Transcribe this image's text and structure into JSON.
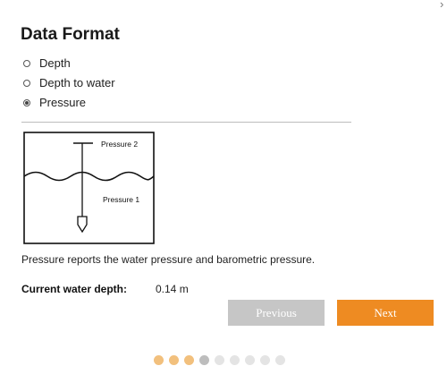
{
  "window": {
    "corner_glyph": "›"
  },
  "page": {
    "title": "Data Format"
  },
  "options": [
    {
      "label": "Depth",
      "selected": false
    },
    {
      "label": "Depth to water",
      "selected": false
    },
    {
      "label": "Pressure",
      "selected": true
    }
  ],
  "diagram": {
    "label_upper": "Pressure 2",
    "label_lower": "Pressure 1"
  },
  "description": "Pressure reports the water pressure and barometric pressure.",
  "depth": {
    "label": "Current water depth:",
    "value": "0.14 m"
  },
  "buttons": {
    "previous": "Previous",
    "next": "Next"
  },
  "pager": {
    "total": 9,
    "current": 4,
    "completed_color": "#f2c07d",
    "current_color": "#bdbdbd",
    "pending_color": "#e4e4e4"
  },
  "colors": {
    "accent": "#ee8b22",
    "disabled_button": "#c6c6c6"
  }
}
